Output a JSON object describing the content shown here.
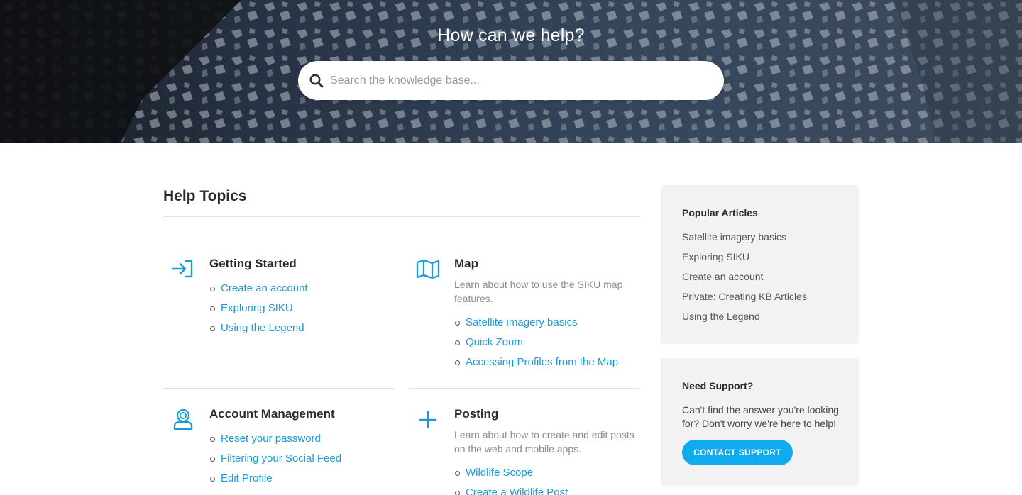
{
  "hero": {
    "title": "How can we help?",
    "search_placeholder": "Search the knowledge base...",
    "search_icon": "search-icon"
  },
  "main": {
    "title": "Help Topics",
    "topics": [
      {
        "title": "Getting Started",
        "icon": "sign-in-arrow-icon",
        "description": "",
        "links": [
          "Create an account",
          "Exploring SIKU",
          "Using the Legend"
        ]
      },
      {
        "title": "Map",
        "icon": "map-icon",
        "description": "Learn about how to use the SIKU map features.",
        "links": [
          "Satellite imagery basics",
          "Quick Zoom",
          "Accessing Profiles from the Map"
        ]
      },
      {
        "title": "Account Management",
        "icon": "user-icon",
        "description": "",
        "links": [
          "Reset your password",
          "Filtering your Social Feed",
          "Edit Profile"
        ]
      },
      {
        "title": "Posting",
        "icon": "plus-icon",
        "description": "Learn about how to create and edit posts on the web and mobile apps.",
        "links": [
          "Wildlife Scope",
          "Create a Wildlife Post"
        ]
      }
    ]
  },
  "sidebar": {
    "popular": {
      "title": "Popular Articles",
      "items": [
        "Satellite imagery basics",
        "Exploring SIKU",
        "Create an account",
        "Private: Creating KB Articles",
        "Using the Legend"
      ]
    },
    "support": {
      "title": "Need Support?",
      "text": "Can't find the answer you're looking for? Don't worry we're here to help!",
      "button_label": "CONTACT SUPPORT"
    }
  },
  "colors": {
    "accent": "#1a9bd7",
    "button": "#10aaef",
    "card_bg": "#f2f2f2"
  }
}
